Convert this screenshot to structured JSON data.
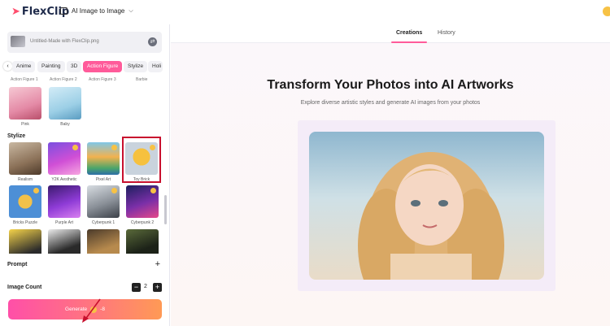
{
  "app": {
    "logo_text": "FlexClip",
    "tool_name": "AI Image to Image"
  },
  "upload": {
    "filename": "Untitled-Made with FlexClip.png"
  },
  "style_tabs": [
    "Anime",
    "Painting",
    "3D",
    "Action Figure",
    "Stylize",
    "Holi"
  ],
  "action_figure": {
    "top_captions": [
      "Action Figure 1",
      "Action Figure 2",
      "Action Figure 3",
      "Barbie"
    ],
    "items": [
      {
        "label": "Pink"
      },
      {
        "label": "Baby"
      }
    ]
  },
  "stylize": {
    "title": "Stylize",
    "items": [
      {
        "label": "Realism"
      },
      {
        "label": "Y2K Aesthetic"
      },
      {
        "label": "Pixel Art"
      },
      {
        "label": "Toy Brick"
      },
      {
        "label": "Bricks Puzzle"
      },
      {
        "label": "Purple Art"
      },
      {
        "label": "Cyberpunk 1"
      },
      {
        "label": "Cyberpunk 2"
      }
    ]
  },
  "prompt": {
    "label": "Prompt"
  },
  "image_count": {
    "label": "Image Count",
    "value": "2"
  },
  "generate": {
    "label": "Generate",
    "cost": "-8"
  },
  "main": {
    "tabs": [
      "Creations",
      "History"
    ],
    "title": "Transform Your Photos into AI Artworks",
    "subtitle": "Explore diverse artistic styles and generate AI images from your photos"
  }
}
